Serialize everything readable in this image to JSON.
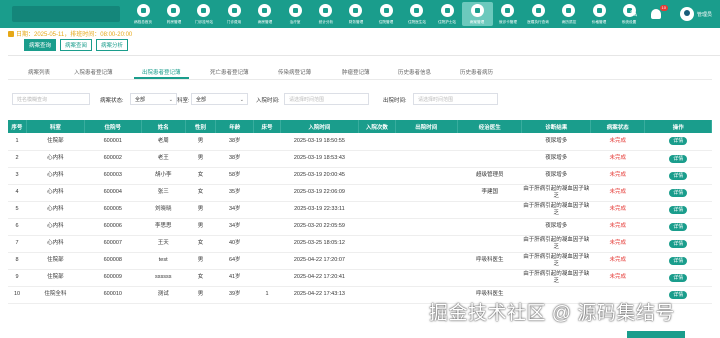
{
  "nav": [
    {
      "label": "病档总首页"
    },
    {
      "label": "药房管理"
    },
    {
      "label": "门诊挂号站"
    },
    {
      "label": "门诊费用"
    },
    {
      "label": "病房管理"
    },
    {
      "label": "治疗室"
    },
    {
      "label": "统计分析"
    },
    {
      "label": "财务管理"
    },
    {
      "label": "住院管理"
    },
    {
      "label": "住院医生站"
    },
    {
      "label": "住院护士站"
    },
    {
      "label": "病案管理",
      "active": true
    },
    {
      "label": "就诊卡管理"
    },
    {
      "label": "医嘱执行查询"
    },
    {
      "label": "病历质控"
    },
    {
      "label": "价格管理"
    },
    {
      "label": "系统设置"
    }
  ],
  "top_right": {
    "badge": "10",
    "username": "管理员"
  },
  "subhead": "日期：2025-05-11，排班时间：08:00-20:00",
  "subtabs": [
    "病案查询",
    "病案查阅",
    "病案分析"
  ],
  "content_tabs": [
    "病案列表",
    "入院患者登记薄",
    "出院患者登记薄",
    "死亡患者登记薄",
    "传染病登记薄",
    "肿瘤登记薄",
    "历史患者信息",
    "历史患者病历"
  ],
  "filters": {
    "name_placeholder": "姓名模糊查询",
    "status_label": "病案状态:",
    "status_value": "全部",
    "dept_label": "科室:",
    "dept_value": "全部",
    "in_label": "入院时间:",
    "in_placeholder": "请选择时间范围",
    "out_label": "出院时间:",
    "out_placeholder": "请选择时间范围"
  },
  "table": {
    "headers": [
      "序号",
      "科室",
      "住院号",
      "姓名",
      "性别",
      "年龄",
      "床号",
      "入院时间",
      "入院次数",
      "出院时间",
      "经治医生",
      "诊断结果",
      "病案状态",
      "操作"
    ],
    "rows": [
      [
        "1",
        "住院部",
        "600001",
        "老周",
        "男",
        "38岁",
        "",
        "2025-03-19 18:50:55",
        "",
        "",
        "",
        "夜尿增多",
        "未完成",
        "详情"
      ],
      [
        "2",
        "心内科",
        "600002",
        "老王",
        "男",
        "38岁",
        "",
        "2025-03-19 18:53:43",
        "",
        "",
        "",
        "夜尿增多",
        "未完成",
        "详情"
      ],
      [
        "3",
        "心内科",
        "600003",
        "胡小李",
        "女",
        "58岁",
        "",
        "2025-03-19 20:00:45",
        "",
        "",
        "超级管理员",
        "夜尿增多",
        "未完成",
        "详情"
      ],
      [
        "4",
        "心内科",
        "600004",
        "张三",
        "女",
        "35岁",
        "",
        "2025-03-19 22:06:09",
        "",
        "",
        "李建国",
        "由于肝病引起的凝血因子缺乏",
        "未完成",
        "详情"
      ],
      [
        "5",
        "心内科",
        "600005",
        "刘晓晓",
        "男",
        "34岁",
        "",
        "2025-03-19 22:33:11",
        "",
        "",
        "",
        "由于肝病引起的凝血因子缺乏",
        "未完成",
        "详情"
      ],
      [
        "6",
        "心内科",
        "600006",
        "李思思",
        "男",
        "34岁",
        "",
        "2025-03-20 22:05:59",
        "",
        "",
        "",
        "夜尿增多",
        "未完成",
        "详情"
      ],
      [
        "7",
        "心内科",
        "600007",
        "王天",
        "女",
        "40岁",
        "",
        "2025-03-25 18:05:12",
        "",
        "",
        "",
        "由于肝病引起的凝血因子缺乏",
        "未完成",
        "详情"
      ],
      [
        "8",
        "住院部",
        "600008",
        "test",
        "男",
        "64岁",
        "",
        "2025-04-22 17:20:07",
        "",
        "",
        "呼吸科医生",
        "由于肝病引起的凝血因子缺乏",
        "未完成",
        "详情"
      ],
      [
        "9",
        "住院部",
        "600009",
        "ssssss",
        "女",
        "41岁",
        "",
        "2025-04-22 17:20:41",
        "",
        "",
        "",
        "由于肝病引起的凝血因子缺乏",
        "未完成",
        "详情"
      ],
      [
        "10",
        "住院全科",
        "600010",
        "测试",
        "男",
        "39岁",
        "1",
        "2025-04-22 17:43:13",
        "",
        "",
        "呼吸科医生",
        "",
        "",
        "详情"
      ]
    ]
  },
  "watermark": "掘金技术社区 @ 源码集结号",
  "colors": {
    "primary": "#1a9d8c",
    "status": "#e53935",
    "date": "#e6a817"
  }
}
